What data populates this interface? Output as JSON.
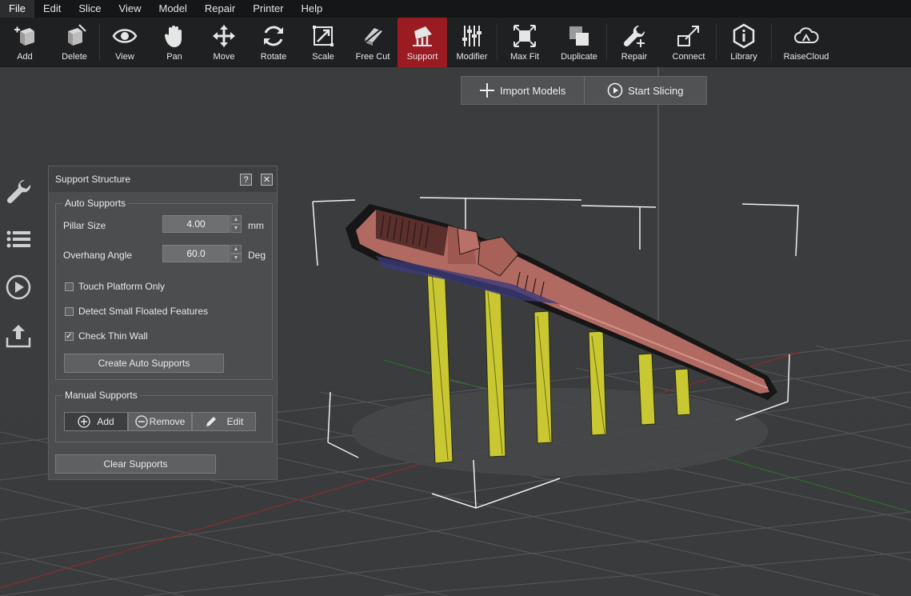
{
  "menu": [
    "File",
    "Edit",
    "Slice",
    "View",
    "Model",
    "Repair",
    "Printer",
    "Help"
  ],
  "toolbar": {
    "add": "Add",
    "delete": "Delete",
    "view": "View",
    "pan": "Pan",
    "move": "Move",
    "rotate": "Rotate",
    "scale": "Scale",
    "free_cut": "Free Cut",
    "support": "Support",
    "modifier": "Modifier",
    "max_fit": "Max Fit",
    "duplicate": "Duplicate",
    "repair": "Repair",
    "connect": "Connect",
    "library": "Library",
    "raisecloud": "RaiseCloud"
  },
  "actions": {
    "import_models": "Import Models",
    "start_slicing": "Start Slicing"
  },
  "panel": {
    "title": "Support Structure",
    "help": "?",
    "close": "✕",
    "auto_supports": {
      "title": "Auto Supports",
      "pillar_size_label": "Pillar Size",
      "pillar_size_value": "4.00",
      "pillar_size_unit": "mm",
      "overhang_angle_label": "Overhang Angle",
      "overhang_angle_value": "60.0",
      "overhang_angle_unit": "Deg",
      "touch_platform_only": "Touch Platform Only",
      "detect_small_floated": "Detect Small Floated Features",
      "check_thin_wall": "Check Thin Wall",
      "create_button": "Create Auto Supports"
    },
    "manual_supports": {
      "title": "Manual Supports",
      "add": "Add",
      "remove": "Remove",
      "edit": "Edit"
    },
    "clear_supports": "Clear Supports"
  },
  "colors": {
    "accent": "#9b1b22",
    "support_pillar": "#c9c832",
    "model": "#b06a62",
    "grid": "#565859"
  }
}
